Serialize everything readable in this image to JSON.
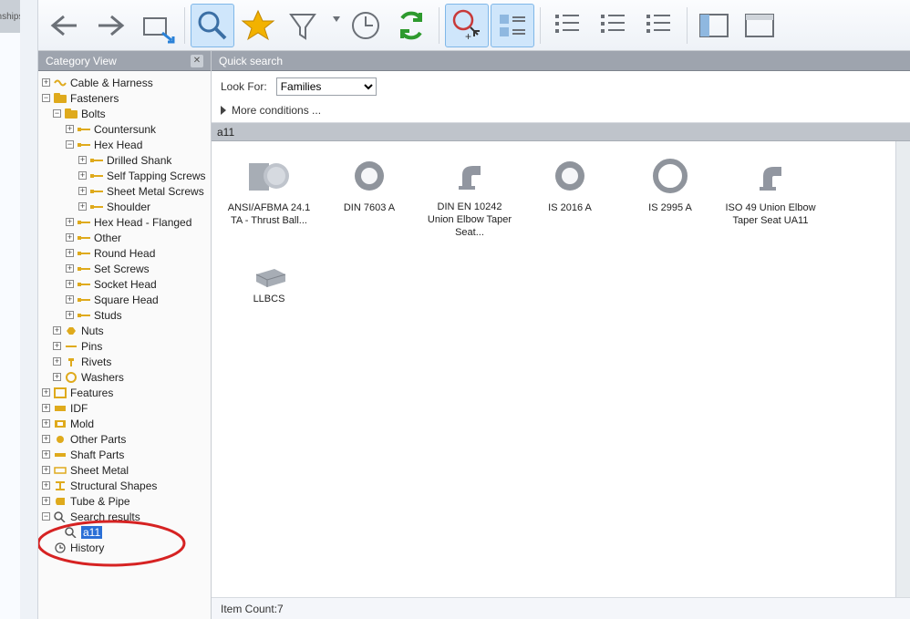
{
  "stub_tab": "nships",
  "toolbar": {
    "buttons": [
      {
        "name": "nav-back",
        "icon": "arrow-left",
        "active": false
      },
      {
        "name": "nav-forward",
        "icon": "arrow-right",
        "active": false
      },
      {
        "name": "open-folder",
        "icon": "folder-arrow",
        "active": false
      },
      {
        "name": "search",
        "icon": "magnifier",
        "active": true
      },
      {
        "name": "favorites",
        "icon": "star",
        "active": false
      },
      {
        "name": "filter",
        "icon": "funnel",
        "active": false
      },
      {
        "name": "filter-menu",
        "icon": "dropdown",
        "active": false
      },
      {
        "name": "history",
        "icon": "clock",
        "active": false
      },
      {
        "name": "refresh",
        "icon": "recycle",
        "active": false
      },
      {
        "name": "auto-refresh",
        "icon": "recycle-cursor",
        "active": true
      },
      {
        "name": "view-details",
        "icon": "list-detail",
        "active": true
      },
      {
        "name": "view-list",
        "icon": "list-small",
        "active": false
      },
      {
        "name": "view-list2",
        "icon": "list-small2",
        "active": false
      },
      {
        "name": "view-list3",
        "icon": "list-small3",
        "active": false
      },
      {
        "name": "pane-layout",
        "icon": "layout-two",
        "active": false
      },
      {
        "name": "pane-single",
        "icon": "layout-one",
        "active": false
      }
    ]
  },
  "sidebar": {
    "title": "Category View",
    "nodes": [
      {
        "indent": 0,
        "expand": "plus",
        "icon": "cable",
        "label": "Cable & Harness"
      },
      {
        "indent": 0,
        "expand": "minus",
        "icon": "folder",
        "label": "Fasteners"
      },
      {
        "indent": 1,
        "expand": "minus",
        "icon": "folder",
        "label": "Bolts"
      },
      {
        "indent": 2,
        "expand": "plus",
        "icon": "bolt",
        "label": "Countersunk"
      },
      {
        "indent": 2,
        "expand": "minus",
        "icon": "bolt",
        "label": "Hex Head"
      },
      {
        "indent": 3,
        "expand": "plus",
        "icon": "bolt",
        "label": "Drilled Shank"
      },
      {
        "indent": 3,
        "expand": "plus",
        "icon": "bolt",
        "label": "Self Tapping Screws"
      },
      {
        "indent": 3,
        "expand": "plus",
        "icon": "bolt",
        "label": "Sheet Metal Screws"
      },
      {
        "indent": 3,
        "expand": "plus",
        "icon": "bolt",
        "label": "Shoulder"
      },
      {
        "indent": 2,
        "expand": "plus",
        "icon": "bolt",
        "label": "Hex Head - Flanged"
      },
      {
        "indent": 2,
        "expand": "plus",
        "icon": "bolt",
        "label": "Other"
      },
      {
        "indent": 2,
        "expand": "plus",
        "icon": "bolt",
        "label": "Round Head"
      },
      {
        "indent": 2,
        "expand": "plus",
        "icon": "bolt",
        "label": "Set Screws"
      },
      {
        "indent": 2,
        "expand": "plus",
        "icon": "bolt",
        "label": "Socket Head"
      },
      {
        "indent": 2,
        "expand": "plus",
        "icon": "bolt",
        "label": "Square Head"
      },
      {
        "indent": 2,
        "expand": "plus",
        "icon": "bolt",
        "label": "Studs"
      },
      {
        "indent": 1,
        "expand": "plus",
        "icon": "nut",
        "label": "Nuts"
      },
      {
        "indent": 1,
        "expand": "plus",
        "icon": "pin",
        "label": "Pins"
      },
      {
        "indent": 1,
        "expand": "plus",
        "icon": "rivet",
        "label": "Rivets"
      },
      {
        "indent": 1,
        "expand": "plus",
        "icon": "washer",
        "label": "Washers"
      },
      {
        "indent": 0,
        "expand": "plus",
        "icon": "feature",
        "label": "Features"
      },
      {
        "indent": 0,
        "expand": "plus",
        "icon": "idf",
        "label": "IDF"
      },
      {
        "indent": 0,
        "expand": "plus",
        "icon": "mold",
        "label": "Mold"
      },
      {
        "indent": 0,
        "expand": "plus",
        "icon": "other",
        "label": "Other Parts"
      },
      {
        "indent": 0,
        "expand": "plus",
        "icon": "shaft",
        "label": "Shaft Parts"
      },
      {
        "indent": 0,
        "expand": "plus",
        "icon": "sheet",
        "label": "Sheet Metal"
      },
      {
        "indent": 0,
        "expand": "plus",
        "icon": "struct",
        "label": "Structural Shapes"
      },
      {
        "indent": 0,
        "expand": "plus",
        "icon": "tube",
        "label": "Tube & Pipe"
      },
      {
        "indent": 0,
        "expand": "minus",
        "icon": "search",
        "label": "Search results"
      },
      {
        "indent": 1,
        "expand": "blank",
        "icon": "search",
        "label": "a11",
        "selected": true
      },
      {
        "indent": 0,
        "expand": "blank",
        "icon": "clock",
        "label": "History"
      }
    ]
  },
  "search": {
    "title": "Quick search",
    "lookfor_label": "Look For:",
    "lookfor_value": "Families",
    "lookfor_options": [
      "Families"
    ],
    "more": "More conditions ..."
  },
  "group": {
    "label": "a11"
  },
  "results": [
    {
      "name": "ANSI/AFBMA 24.1 TA - Thrust Ball...",
      "thumb": "thrust"
    },
    {
      "name": "DIN 7603 A",
      "thumb": "ring"
    },
    {
      "name": "DIN EN 10242 Union Elbow Taper Seat...",
      "thumb": "elbow"
    },
    {
      "name": "IS 2016 A",
      "thumb": "ring"
    },
    {
      "name": "IS 2995 A",
      "thumb": "ring-open"
    },
    {
      "name": "ISO 49 Union Elbow Taper Seat UA11",
      "thumb": "elbow"
    },
    {
      "name": "LLBCS",
      "thumb": "block"
    }
  ],
  "status": {
    "item_count_label": "Item Count:",
    "item_count_value": "7"
  }
}
